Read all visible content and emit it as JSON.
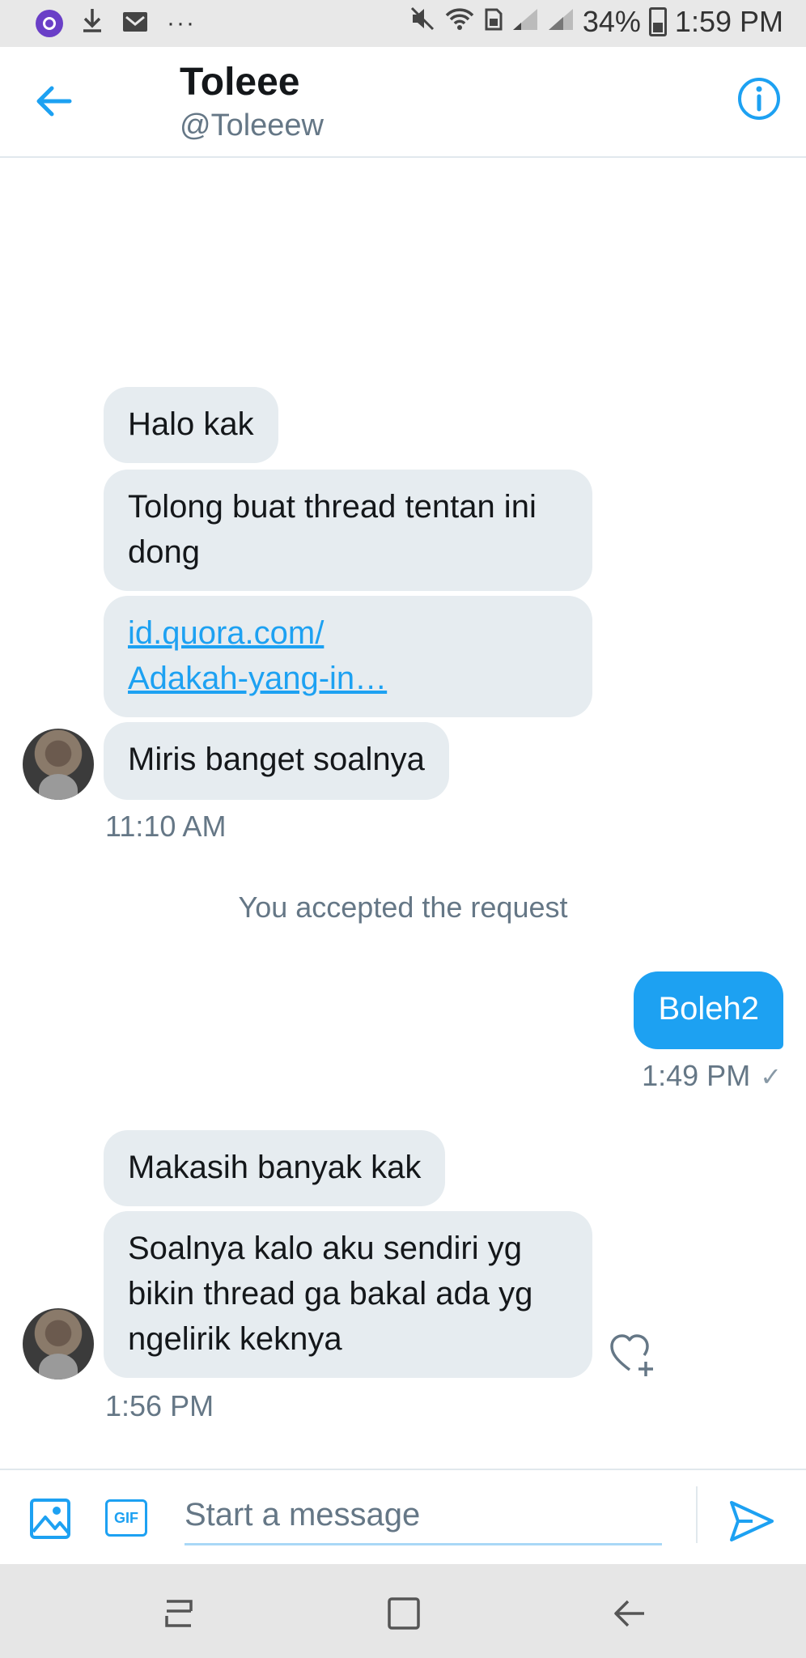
{
  "status_bar": {
    "battery": "34%",
    "time": "1:59 PM",
    "dots": "···"
  },
  "header": {
    "name": "Toleee",
    "handle": "@Toleeew"
  },
  "messages": {
    "m1": "Halo kak",
    "m2": "Tolong buat thread tentan ini dong",
    "m3": "id.quora.com/\nAdakah-yang-in…",
    "m4": "Miris banget soalnya",
    "t1": "11:10 AM",
    "system": "You accepted the request",
    "m5": "Boleh2",
    "t2": "1:49 PM",
    "m6": "Makasih banyak kak",
    "m7": "Soalnya kalo aku sendiri yg bikin thread ga bakal ada yg ngelirik keknya",
    "t3": "1:56 PM"
  },
  "composer": {
    "placeholder": "Start a message",
    "gif_label": "GIF"
  },
  "colors": {
    "accent": "#1da1f2",
    "incoming_bubble": "#e6ecf0",
    "muted_text": "#657786"
  }
}
